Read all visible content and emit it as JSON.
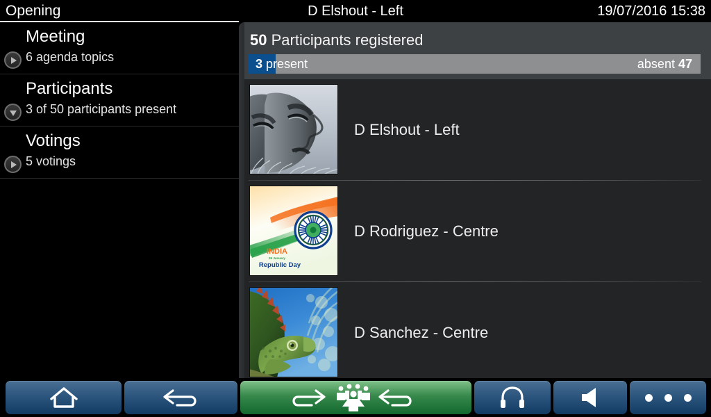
{
  "titlebar": {
    "left": "Opening",
    "center": "D Elshout - Left",
    "right": "19/07/2016 15:38"
  },
  "sidebar": {
    "items": [
      {
        "title": "Meeting",
        "subtitle": "6 agenda topics",
        "toggle_icon": "triangle-right-icon",
        "expanded": false
      },
      {
        "title": "Participants",
        "subtitle": "3 of 50 participants present",
        "toggle_icon": "triangle-down-icon",
        "expanded": true
      },
      {
        "title": "Votings",
        "subtitle": "5 votings",
        "toggle_icon": "triangle-right-icon",
        "expanded": false
      }
    ]
  },
  "main": {
    "header": {
      "count": "50",
      "title_rest": " Participants registered"
    },
    "progress": {
      "present_count": "3",
      "present_label": "present",
      "absent_label": "absent",
      "absent_count": "47",
      "present_fill_percent": 6,
      "fill_color": "#0b4f8f",
      "track_color": "#8d8f90"
    },
    "participants": [
      {
        "name": "D Elshout - Left",
        "thumbnail": "stone-face-sculpture-photo"
      },
      {
        "name": "D Rodriguez - Centre",
        "thumbnail": "india-republic-day-flag-photo"
      },
      {
        "name": "D Sanchez - Centre",
        "thumbnail": "green-iguana-photo"
      }
    ]
  },
  "toolbar": {
    "buttons": [
      {
        "name": "home-button",
        "icon": "home-icon",
        "color": "#2d567e"
      },
      {
        "name": "back-button",
        "icon": "back-arrow-icon",
        "color": "#2d567e"
      },
      {
        "name": "meeting-mode-button",
        "icon": "forward-arrow-icon + conference-group-icon + back-arrow-icon",
        "color": "#37894b"
      },
      {
        "name": "headphones-button",
        "icon": "headphones-icon",
        "color": "#2d567e"
      },
      {
        "name": "speaker-button",
        "icon": "speaker-icon",
        "color": "#2d567e"
      },
      {
        "name": "more-button",
        "icon": "three-dots-icon",
        "color": "#2d567e"
      }
    ]
  }
}
